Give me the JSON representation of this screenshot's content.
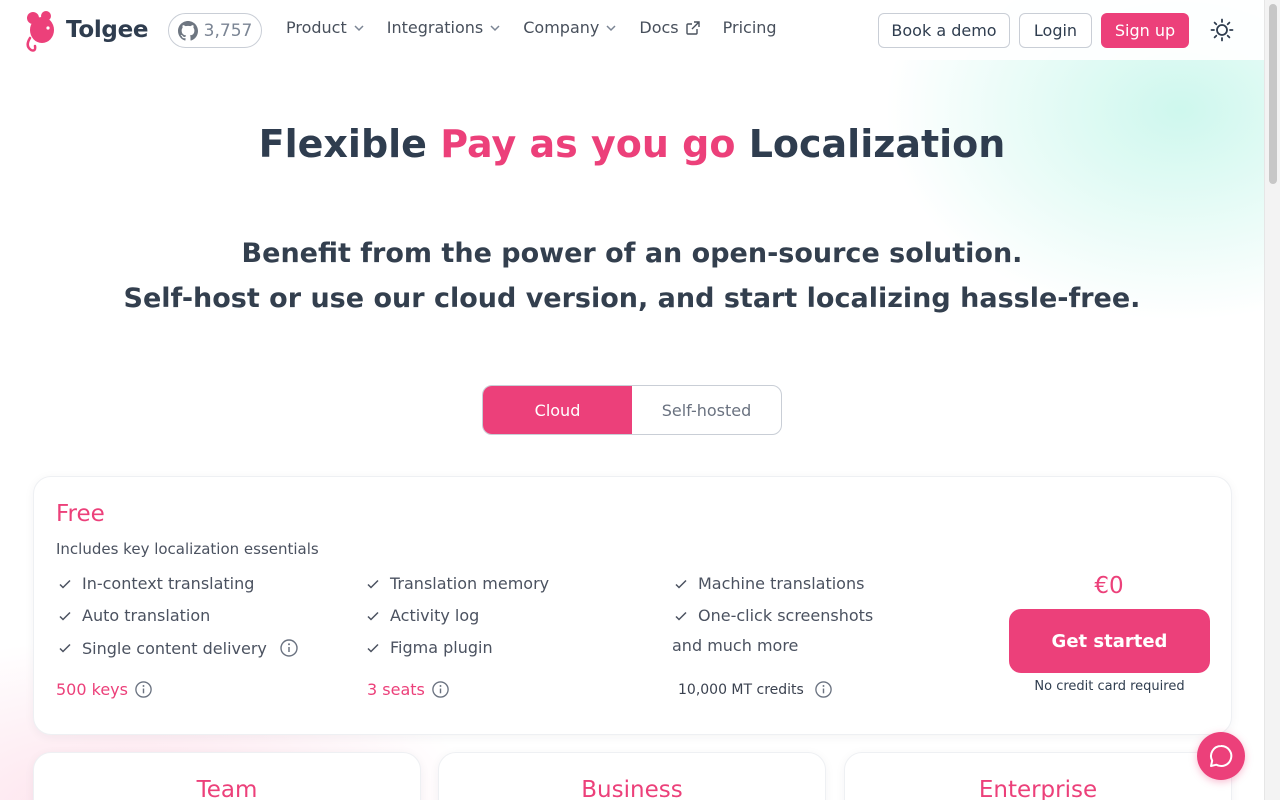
{
  "brand": {
    "name": "Tolgee",
    "accent": "#ec407a"
  },
  "header": {
    "github_stars": "3,757",
    "nav": [
      {
        "label": "Product",
        "icon": "chevron-down-icon"
      },
      {
        "label": "Integrations",
        "icon": "chevron-down-icon"
      },
      {
        "label": "Company",
        "icon": "chevron-down-icon"
      },
      {
        "label": "Docs",
        "icon": "external-link-icon"
      },
      {
        "label": "Pricing",
        "icon": ""
      }
    ],
    "book_demo": "Book a demo",
    "login": "Login",
    "signup": "Sign up"
  },
  "hero": {
    "title_before": "Flexible",
    "title_accent": "Pay as you go",
    "title_after": "Localization",
    "subtitle_line1": "Benefit from the power of an open-source solution.",
    "subtitle_line2": "Self-host or use our cloud version, and start localizing hassle-free."
  },
  "hosting_toggle": {
    "options": [
      "Cloud",
      "Self-hosted"
    ],
    "selected": "Cloud"
  },
  "free_plan": {
    "name": "Free",
    "description": "Includes key localization essentials",
    "features": [
      "In-context translating",
      "Auto translation",
      "Single content delivery",
      "Translation memory",
      "Activity log",
      "Figma plugin",
      "Machine translations",
      "One-click screenshots"
    ],
    "more": "and much more",
    "limits": {
      "keys": "500 keys",
      "seats": "3 seats",
      "mt_credits": "10,000 MT credits"
    },
    "price": "€0",
    "cta": "Get started",
    "note": "No credit card required"
  },
  "other_plans": [
    "Team",
    "Business",
    "Enterprise"
  ]
}
